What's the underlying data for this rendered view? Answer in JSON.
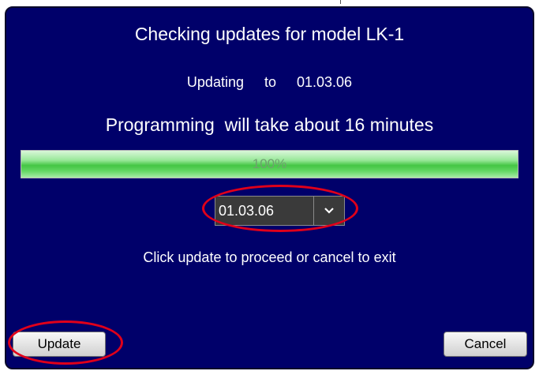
{
  "dialog": {
    "title": "Checking updates for model LK-1",
    "updating_label": "Updating  to  01.03.06",
    "programming_message": "Programming  will take about 16 minutes",
    "instruction": "Click update to proceed or cancel to exit"
  },
  "progress": {
    "value_percent": 100,
    "label": "100%"
  },
  "version_select": {
    "selected": "01.03.06"
  },
  "buttons": {
    "update_label": "Update",
    "cancel_label": "Cancel"
  },
  "icons": {
    "dropdown": "chevron-down-icon"
  },
  "colors": {
    "dialog_background": "#00006a",
    "highlight_ring": "#e0001a",
    "progress_fill": "#44c644"
  }
}
